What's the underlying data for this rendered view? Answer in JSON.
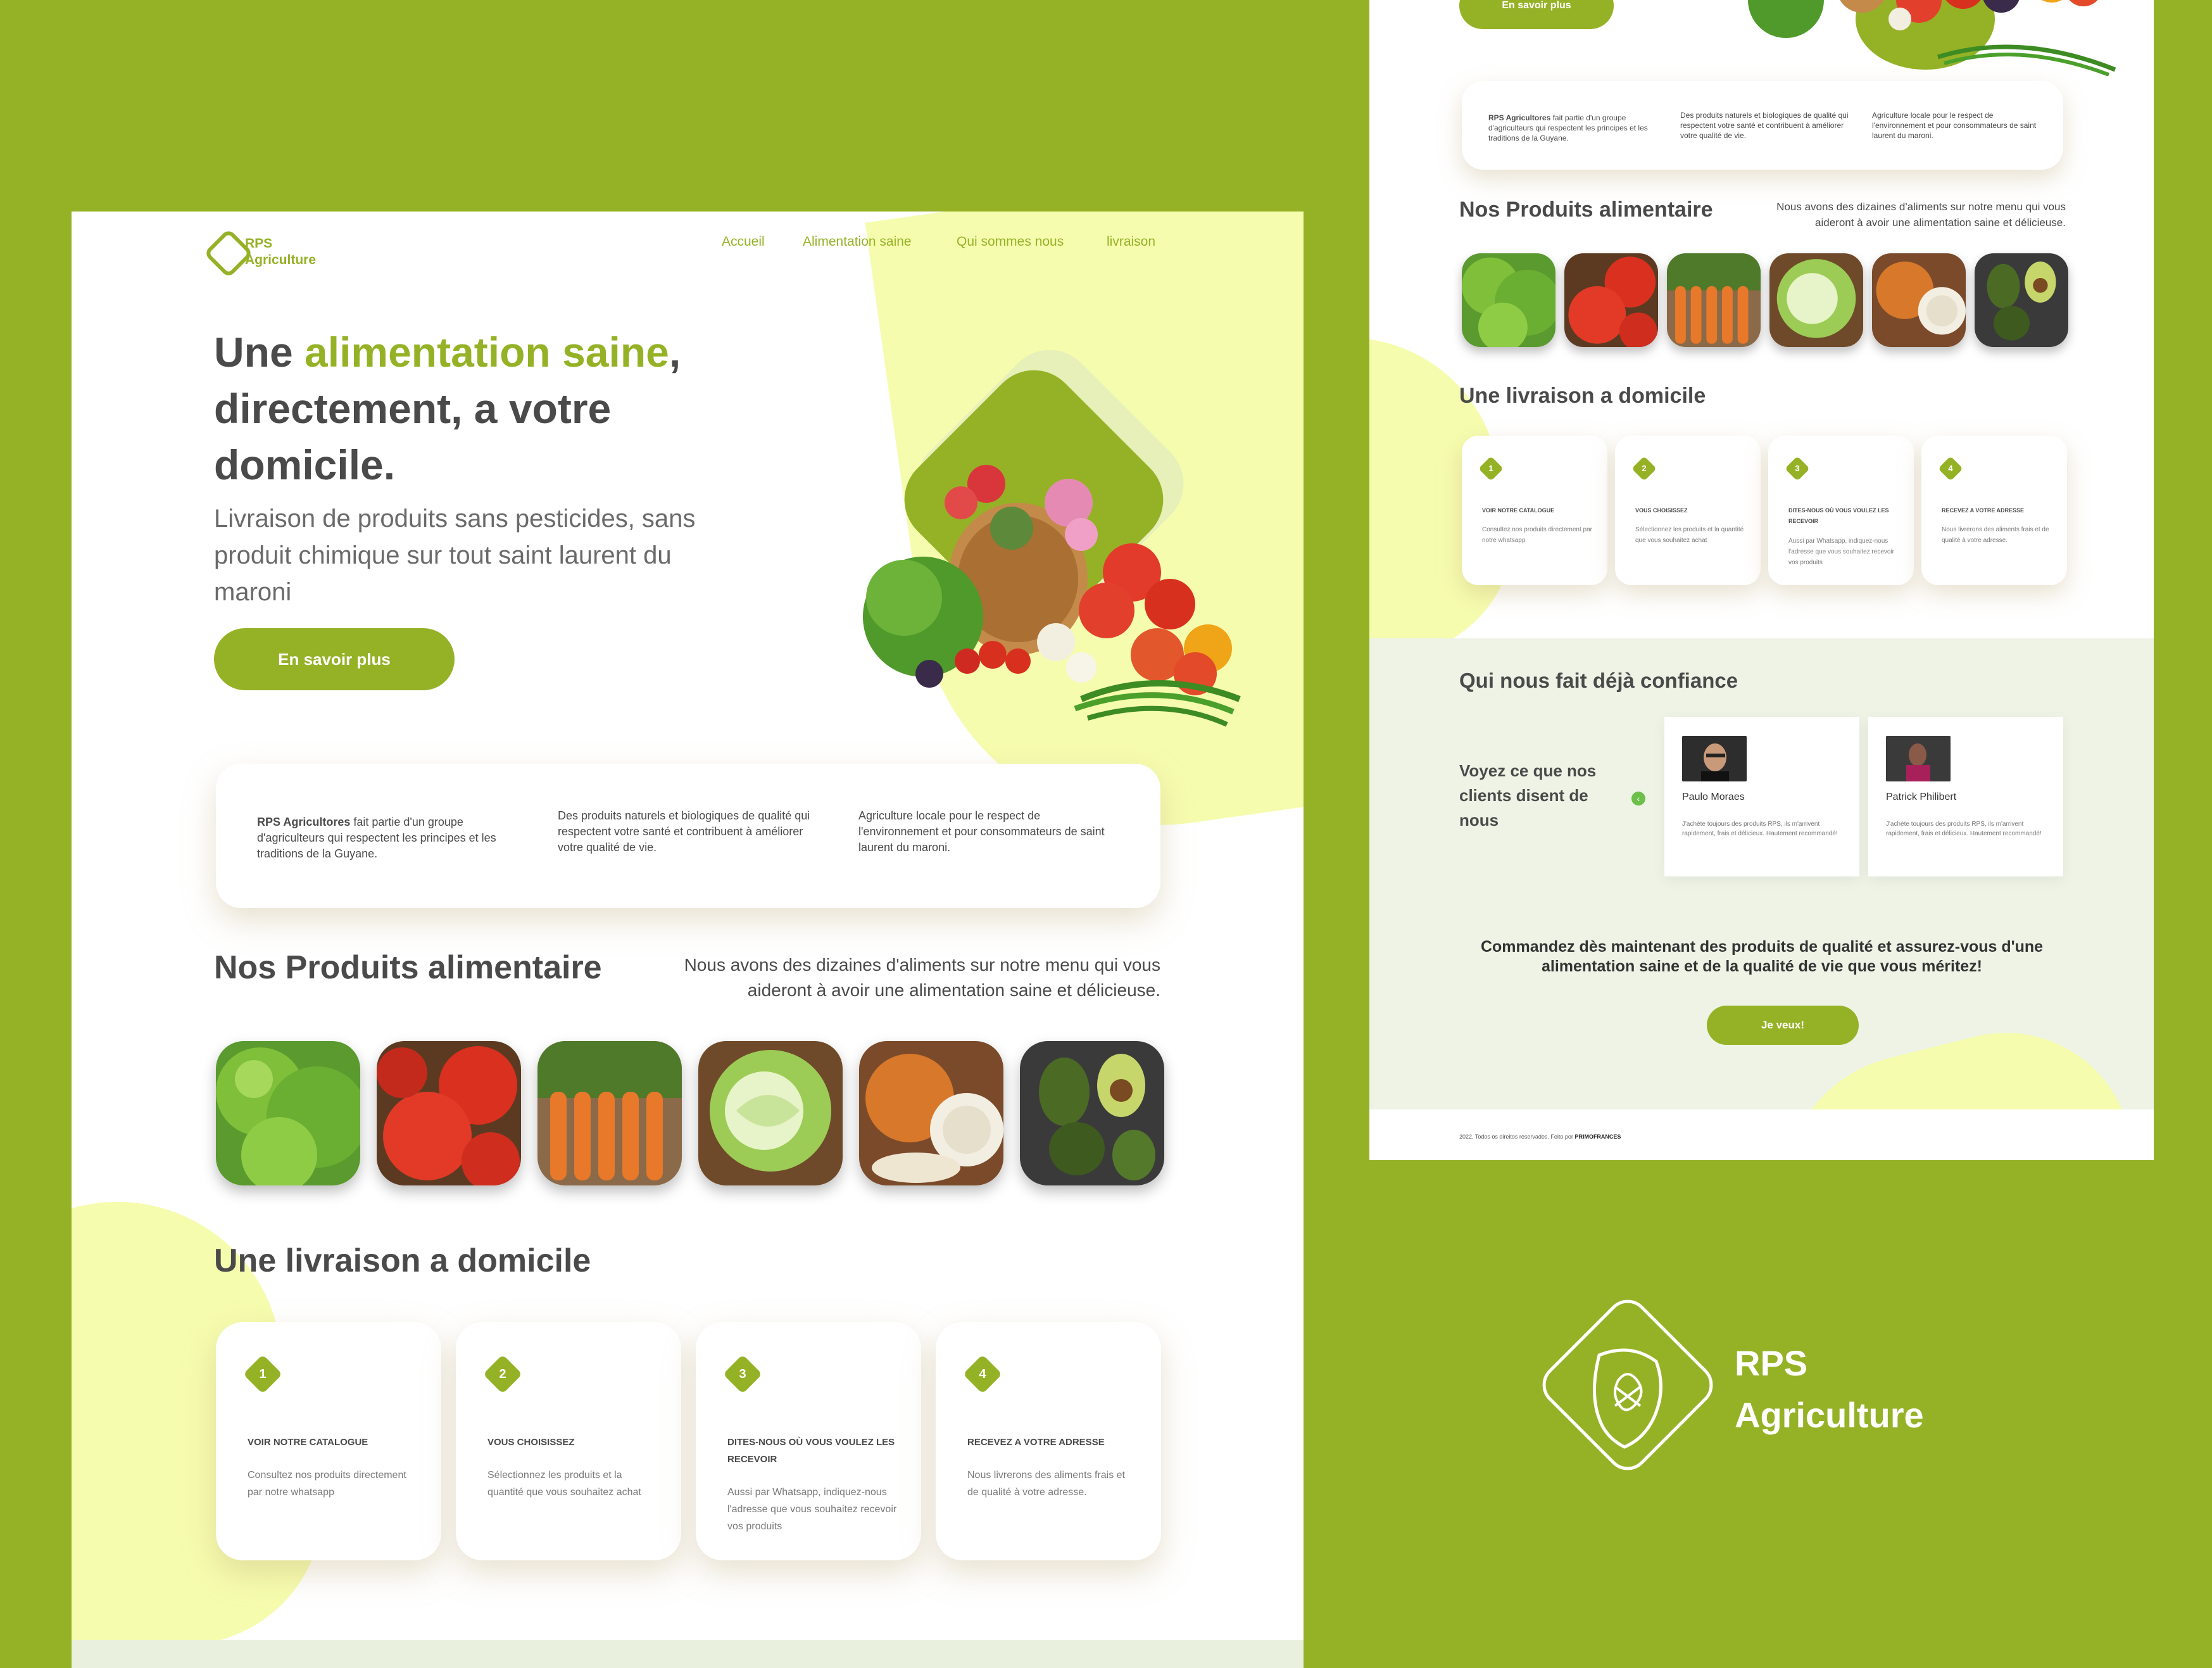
{
  "brand": {
    "logo_line1": "RPS",
    "logo_line2": "Agriculture",
    "brand_line1": "RPS",
    "brand_line2": "Agriculture"
  },
  "colors": {
    "background": "#95b226",
    "accent": "#95b226",
    "blob": "#f6fcae",
    "text": "#4a4a4a",
    "testimonial_bg": "#eef3e6"
  },
  "nav": {
    "items": [
      {
        "label": "Accueil"
      },
      {
        "label": "Alimentation saine"
      },
      {
        "label": "Qui sommes nous"
      },
      {
        "label": "livraison"
      }
    ]
  },
  "hero": {
    "title_part1": "Une ",
    "title_accent": "alimentation saine",
    "title_part2": ",",
    "title_line2": "directement, a votre",
    "title_line3": "domicile.",
    "subtitle": "Livraison de produits sans pesticides, sans produit chimique sur tout saint laurent du maroni",
    "cta_label": "En savoir plus"
  },
  "info": {
    "col1_bold": "RPS Agricultores",
    "col1_rest": " fait partie d'un groupe d'agriculteurs qui respectent les principes et les traditions de la Guyane.",
    "col2": "Des produits naturels et biologiques de qualité qui respectent votre santé et contribuent à améliorer votre qualité de vie.",
    "col3": "Agriculture locale pour le respect de l'environnement et pour consommateurs de saint laurent du maroni."
  },
  "products": {
    "title": "Nos Produits alimentaire",
    "description": "Nous avons des dizaines d'aliments sur notre menu qui vous aideront à avoir une alimentation saine et délicieuse.",
    "items": [
      {
        "icon": "lettuce-image"
      },
      {
        "icon": "tomato-image"
      },
      {
        "icon": "carrot-image"
      },
      {
        "icon": "cabbage-image"
      },
      {
        "icon": "onion-image"
      },
      {
        "icon": "avocado-image"
      }
    ]
  },
  "delivery": {
    "title": "Une livraison a domicile",
    "steps": [
      {
        "num": "1",
        "title": "VOIR NOTRE CATALOGUE",
        "text": "Consultez nos produits directement par notre whatsapp"
      },
      {
        "num": "2",
        "title": "VOUS CHOISISSEZ",
        "text": "Sélectionnez les produits et la quantité que vous souhaitez achat"
      },
      {
        "num": "3",
        "title": "DITES-NOUS OÙ VOUS VOULEZ LES RECEVOIR",
        "text": "Aussi par Whatsapp, indiquez-nous l'adresse que vous souhaitez recevoir vos produits"
      },
      {
        "num": "4",
        "title": "RECEVEZ A VOTRE ADRESSE",
        "text": "Nous livrerons des aliments frais et de  qualité à votre adresse."
      }
    ]
  },
  "testimonials": {
    "title": "Qui nous fait déjà confiance",
    "intro": "Voyez ce que nos clients disent de nous",
    "items": [
      {
        "name": "Paulo Moraes",
        "text": "J'achète toujours des produits RPS, ils m'arrivent rapidement, frais et délicieux. Hautement recommandé!"
      },
      {
        "name": "Patrick Philibert",
        "text": "J'achète toujours des produits RPS, ils m'arrivent rapidement, frais et délicieux. Hautement recommandé!"
      }
    ]
  },
  "cta": {
    "text": "Commandez dès maintenant des produits de qualité et assurez-vous d'une alimentation saine et de la qualité de vie que vous méritez!",
    "button_label": "Je veux!"
  },
  "footer": {
    "copyright": "2022, Todos os direitos reservados. Feito por ",
    "maker": "PRIMOFRANCES"
  }
}
